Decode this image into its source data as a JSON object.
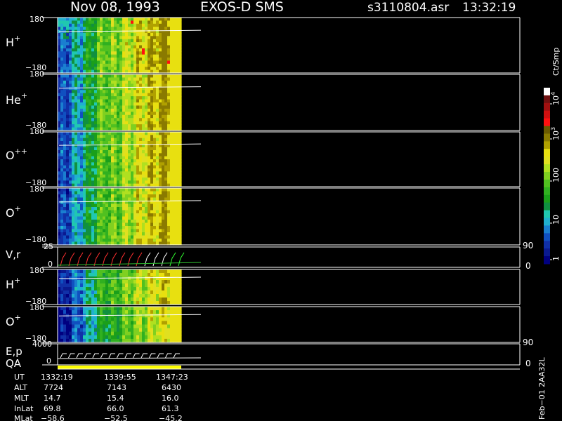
{
  "header": {
    "date": "Nov 08, 1993",
    "instrument": "EXOS-D SMS",
    "file": "s3110804.asr",
    "time": "13:32:19"
  },
  "colorbar": {
    "label": "Ct/Smp",
    "ticks": [
      "1",
      "10",
      "100",
      "10",
      "10"
    ],
    "exponents": [
      "",
      "",
      "",
      "3",
      "4"
    ],
    "colors": [
      "#000080",
      "#0a1a90",
      "#1030a8",
      "#1050c0",
      "#1a7fd0",
      "#20b0d0",
      "#20c8b0",
      "#109040",
      "#1a9f1a",
      "#30b020",
      "#50c020",
      "#80d020",
      "#b0e020",
      "#e0e020",
      "#e8e010",
      "#b0a000",
      "#8a7a00",
      "#6a5a00",
      "#ff1010",
      "#d01010",
      "#a01010",
      "#701010",
      "#ffffff"
    ]
  },
  "panels": [
    {
      "label": "H",
      "sup": "+",
      "ytop": "180",
      "ybot": "−180"
    },
    {
      "label": "He",
      "sup": "+",
      "ytop": "180",
      "ybot": "−180"
    },
    {
      "label": "O",
      "sup": "++",
      "ytop": "180",
      "ybot": "−180"
    },
    {
      "label": "O",
      "sup": "+",
      "ytop": "180",
      "ybot": "−180"
    },
    {
      "label": "V,r",
      "sup": "",
      "ytop": "25",
      "ybot": "0",
      "rtop": "90",
      "rbot": "0"
    },
    {
      "label": "H",
      "sup": "+",
      "ytop": "180",
      "ybot": "−180"
    },
    {
      "label": "O",
      "sup": "+",
      "ytop": "180",
      "ybot": "−180"
    },
    {
      "label": "E,p",
      "sup": "",
      "label2": "QA",
      "ytop": "4000",
      "ybot": "0",
      "rtop": "90",
      "rbot": "0"
    }
  ],
  "footer": {
    "rows": [
      {
        "name": "UT",
        "values": [
          "1332:19",
          "1339:55",
          "1347:23"
        ]
      },
      {
        "name": "ALT",
        "values": [
          "7724",
          "7143",
          "6430"
        ]
      },
      {
        "name": "MLT",
        "values": [
          "14.7",
          "15.4",
          "16.0"
        ]
      },
      {
        "name": "InLat",
        "values": [
          "69.8",
          "66.0",
          "61.3"
        ]
      },
      {
        "name": "MLat",
        "values": [
          "−58.6",
          "−52.5",
          "−45.2"
        ]
      }
    ],
    "stamp": "Feb−01 2AA32L"
  },
  "chart_data": {
    "type": "heatmap",
    "title": "Nov 08, 1993   EXOS-D SMS",
    "x": [
      "1332:19",
      "1339:55",
      "1347:23"
    ],
    "colorbar_label": "Ct/Smp",
    "colorbar_scale": "log",
    "colorbar_range": [
      1,
      10000
    ],
    "series": [
      {
        "name": "H+",
        "ylim": [
          -180,
          180
        ]
      },
      {
        "name": "He+",
        "ylim": [
          -180,
          180
        ]
      },
      {
        "name": "O++",
        "ylim": [
          -180,
          180
        ]
      },
      {
        "name": "O+",
        "ylim": [
          -180,
          180
        ]
      },
      {
        "name": "V,r",
        "ylim": [
          0,
          25
        ],
        "right_ylim": [
          0,
          90
        ]
      },
      {
        "name": "H+",
        "ylim": [
          -180,
          180
        ]
      },
      {
        "name": "O+",
        "ylim": [
          -180,
          180
        ]
      },
      {
        "name": "E,p",
        "ylim": [
          0,
          4000
        ],
        "right_ylim": [
          0,
          90
        ]
      }
    ]
  }
}
